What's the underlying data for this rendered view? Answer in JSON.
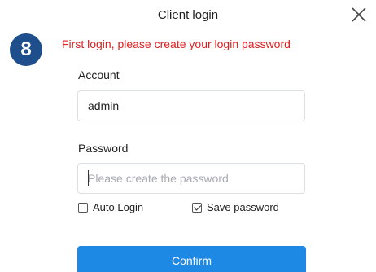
{
  "dialog": {
    "title": "Client login",
    "close_icon": "close-icon"
  },
  "step_badge": "8",
  "notice": "First login, please create your login password",
  "account": {
    "label": "Account",
    "value": "admin"
  },
  "password": {
    "label": "Password",
    "value": "",
    "placeholder": "Please create the password"
  },
  "options": {
    "auto_login": {
      "label": "Auto Login",
      "checked": false
    },
    "save_password": {
      "label": "Save password",
      "checked": true
    }
  },
  "confirm_label": "Confirm",
  "colors": {
    "accent": "#1e88e5",
    "notice": "#e02020",
    "badge": "#1f4e8c"
  }
}
